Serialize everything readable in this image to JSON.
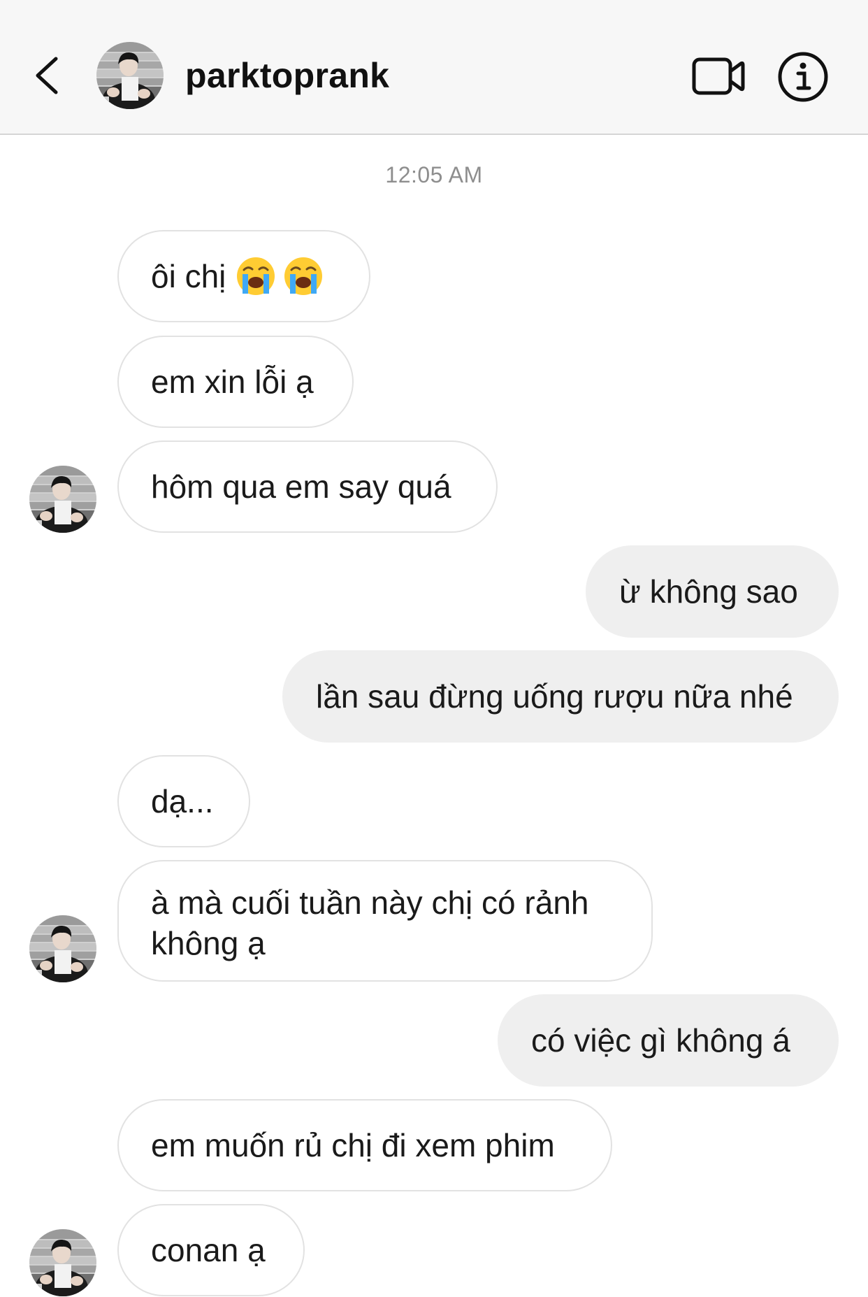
{
  "header": {
    "username": "parktoprank",
    "icons": [
      "back-icon",
      "avatar",
      "video-call-icon",
      "info-icon"
    ]
  },
  "timestamp": "12:05 AM",
  "messages": [
    {
      "from": "them",
      "text": "ôi chị",
      "emoji": [
        "loudly-crying-face",
        "loudly-crying-face"
      ]
    },
    {
      "from": "them",
      "text": "em xin lỗi ạ"
    },
    {
      "from": "them",
      "text": "hôm qua em say quá"
    },
    {
      "from": "me",
      "text": "ừ không sao"
    },
    {
      "from": "me",
      "text": "lần sau đừng uống rượu nữa nhé"
    },
    {
      "from": "them",
      "text": "dạ..."
    },
    {
      "from": "them",
      "text": "à mà cuối tuần này chị có rảnh không ạ"
    },
    {
      "from": "me",
      "text": "có việc gì không á"
    },
    {
      "from": "them",
      "text": "em muốn rủ chị đi xem phim"
    },
    {
      "from": "them",
      "text": "conan ạ"
    }
  ],
  "colors": {
    "header_bg": "#f7f7f7",
    "incoming_border": "#e2e2e2",
    "outgoing_bg": "#efefef",
    "timestamp": "#8e8e8e"
  }
}
